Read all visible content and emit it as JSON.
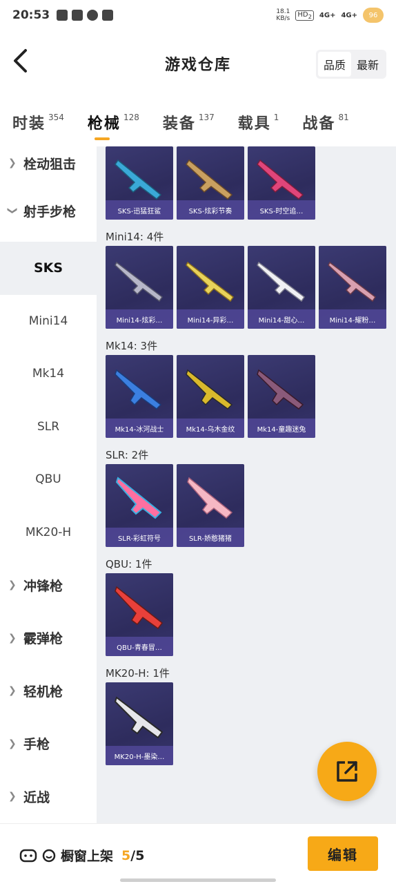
{
  "status": {
    "time": "20:53",
    "net_speed_value": "18.1",
    "net_speed_unit": "KB/s",
    "hd_badge": "HD",
    "sim_index": "2",
    "signal1": "4G+",
    "signal2": "4G+",
    "battery": "96"
  },
  "header": {
    "title": "游戏仓库",
    "sort_quality": "品质",
    "sort_newest": "最新"
  },
  "tabs": [
    {
      "label": "时装",
      "count": "354"
    },
    {
      "label": "枪械",
      "count": "128"
    },
    {
      "label": "装备",
      "count": "137"
    },
    {
      "label": "载具",
      "count": "1"
    },
    {
      "label": "战备",
      "count": "81"
    }
  ],
  "sidebar": {
    "items": [
      {
        "label": "栓动狙击",
        "type": "group"
      },
      {
        "label": "射手步枪",
        "type": "group-open"
      },
      {
        "label": "SKS",
        "type": "active"
      },
      {
        "label": "Mini14",
        "type": "sub"
      },
      {
        "label": "Mk14",
        "type": "sub"
      },
      {
        "label": "SLR",
        "type": "sub"
      },
      {
        "label": "QBU",
        "type": "sub"
      },
      {
        "label": "MK20-H",
        "type": "sub"
      },
      {
        "label": "冲锋枪",
        "type": "group"
      },
      {
        "label": "霰弹枪",
        "type": "group"
      },
      {
        "label": "轻机枪",
        "type": "group"
      },
      {
        "label": "手枪",
        "type": "group"
      },
      {
        "label": "近战",
        "type": "group"
      }
    ]
  },
  "sections": [
    {
      "label": "",
      "items": [
        "SKS-迅猛狂鲨",
        "SKS-炫彩节奏",
        "SKS-时空追…"
      ]
    },
    {
      "label": "Mini14: 4件",
      "items": [
        "Mini14-炫彩…",
        "Mini14-异彩…",
        "Mini14-甜心…",
        "Mini14-耀粉…"
      ]
    },
    {
      "label": "Mk14: 3件",
      "items": [
        "Mk14-冰河战士",
        "Mk14-乌木金纹",
        "Mk14-童趣迷兔"
      ]
    },
    {
      "label": "SLR: 2件",
      "items": [
        "SLR-彩虹符号",
        "SLR-娇憨猪猪"
      ]
    },
    {
      "label": "QBU: 1件",
      "items": [
        "QBU-青春冒…"
      ]
    },
    {
      "label": "MK20-H: 1件",
      "items": [
        "MK20-H-墨染…"
      ]
    }
  ],
  "bottom": {
    "showcase_label": "橱窗上架",
    "count_current": "5",
    "count_sep": "/",
    "count_total": "5",
    "edit_label": "编辑"
  },
  "colors": {
    "accent": "#f7a917",
    "card_bg": "#2e2c5d",
    "content_bg": "#eef0f3"
  }
}
